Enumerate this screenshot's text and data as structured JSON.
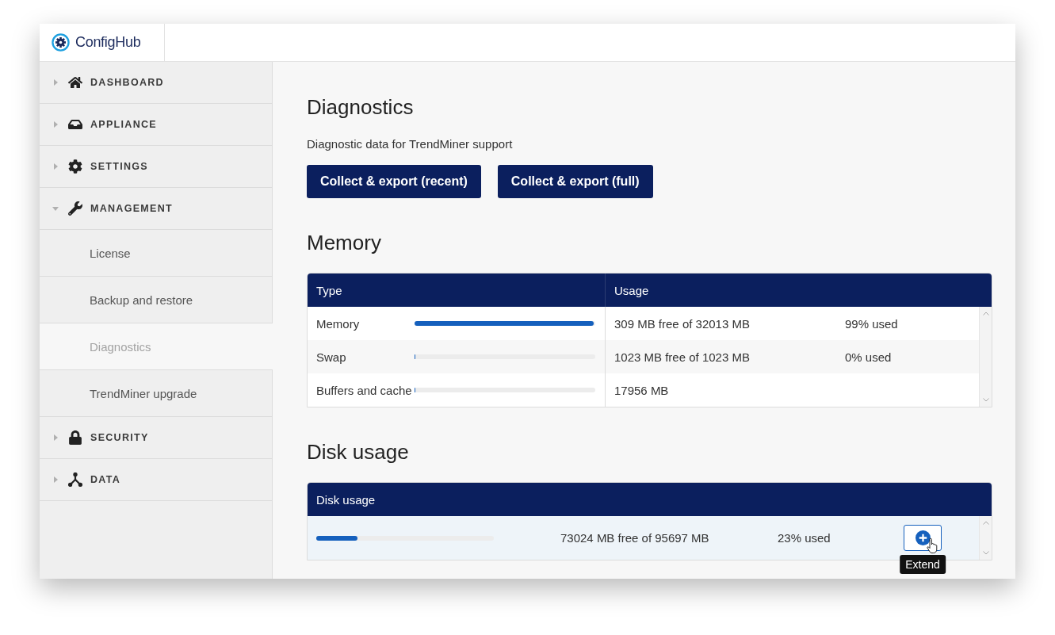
{
  "header": {
    "logo": "ConfigHub"
  },
  "sidebar": {
    "items": [
      {
        "label": "DASHBOARD",
        "expanded": false
      },
      {
        "label": "APPLIANCE",
        "expanded": false
      },
      {
        "label": "SETTINGS",
        "expanded": false
      },
      {
        "label": "MANAGEMENT",
        "expanded": true,
        "children": [
          {
            "label": "License",
            "selected": false
          },
          {
            "label": "Backup and restore",
            "selected": false
          },
          {
            "label": "Diagnostics",
            "selected": true
          },
          {
            "label": "TrendMiner upgrade",
            "selected": false
          }
        ]
      },
      {
        "label": "SECURITY",
        "expanded": false
      },
      {
        "label": "DATA",
        "expanded": false
      }
    ]
  },
  "diagnostics": {
    "title": "Diagnostics",
    "description": "Diagnostic data for TrendMiner support",
    "buttons": [
      "Collect & export (recent)",
      "Collect & export (full)"
    ]
  },
  "memory": {
    "title": "Memory",
    "columns": [
      "Type",
      "Usage"
    ],
    "rows": [
      {
        "type": "Memory",
        "level": 0.99,
        "free": "309 MB free of 32013 MB",
        "used": "99% used"
      },
      {
        "type": "Swap",
        "level": 0,
        "free": "1023 MB free of 1023 MB",
        "used": "0% used"
      },
      {
        "type": "Buffers and cache",
        "level": 0,
        "free": "17956 MB"
      }
    ]
  },
  "disk": {
    "title": "Disk usage",
    "columns": [
      "Disk usage"
    ],
    "rows": [
      {
        "level": 0.23,
        "free": "73024 MB free of 95697 MB",
        "used": "23% used",
        "tooltip": "Extend"
      }
    ]
  }
}
